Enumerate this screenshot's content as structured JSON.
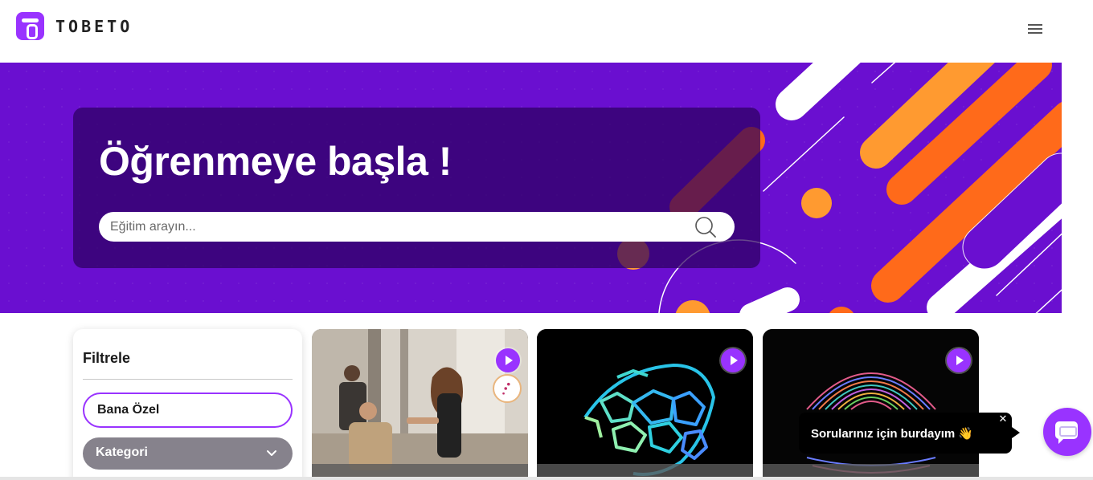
{
  "header": {
    "logo_text": "TOBETO"
  },
  "hero": {
    "title": "Öğrenmeye başla !",
    "search_placeholder": "Eğitim arayın..."
  },
  "filter": {
    "title": "Filtrele",
    "special_label": "Bana Özel",
    "category_label": "Kategori"
  },
  "chat": {
    "tooltip_text": "Sorularınız için burdayım 👋",
    "close_symbol": "✕"
  },
  "colors": {
    "brand_purple": "#9933ff",
    "hero_background": "#6a0fd0",
    "accent_orange": "#ff6a1a"
  }
}
